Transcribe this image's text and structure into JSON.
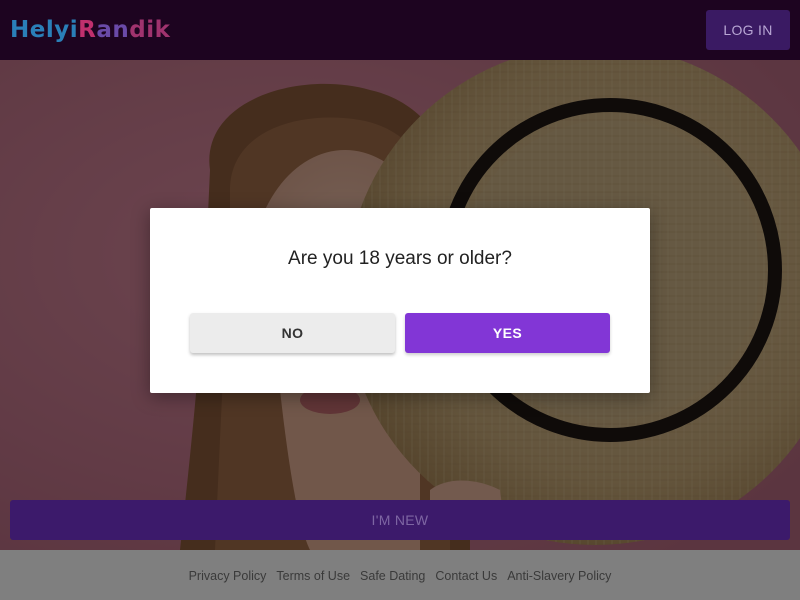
{
  "header": {
    "logo_parts": [
      {
        "text": "Helyi",
        "color": "#2a7fb8"
      },
      {
        "text": "R",
        "color": "#c0306d"
      },
      {
        "text": "an",
        "color": "#6a4aa8"
      },
      {
        "text": "dik",
        "color": "#a0336e"
      }
    ],
    "login_label": "LOG IN"
  },
  "modal": {
    "question": "Are you 18 years or older?",
    "no_label": "NO",
    "yes_label": "YES"
  },
  "hero": {
    "new_label": "I'M NEW"
  },
  "footer": {
    "links": [
      "Privacy Policy",
      "Terms of Use",
      "Safe Dating",
      "Contact Us",
      "Anti-Slavery Policy"
    ]
  },
  "colors": {
    "accent": "#8236d6",
    "header_bg": "#1d0420"
  }
}
